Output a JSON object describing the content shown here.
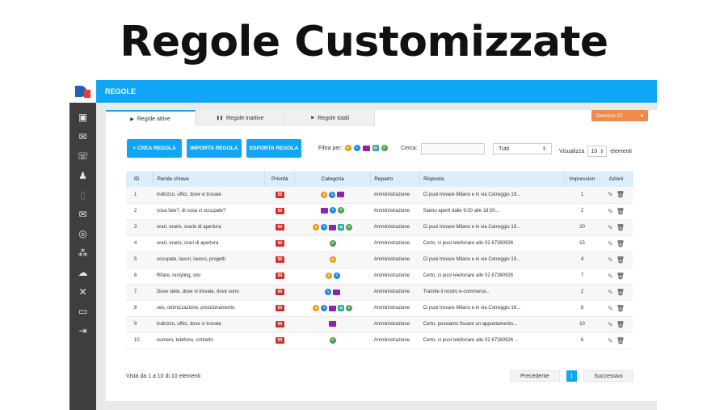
{
  "headline": "Regole Customizzate",
  "topbar": {
    "title": "REGOLE"
  },
  "sidebar": {
    "icons": [
      "dashboard-icon",
      "inbox-icon",
      "support-icon",
      "team-icon",
      "tablet-icon",
      "mail-settings-icon",
      "check-circle-icon",
      "network-icon",
      "chat-icon",
      "tools-icon",
      "monitor-icon",
      "logout-icon"
    ]
  },
  "tabs": [
    {
      "label": "Regole attive",
      "glyph": "▶"
    },
    {
      "label": "Regole inattive",
      "glyph": "❚❚"
    },
    {
      "label": "Regole totali",
      "glyph": "⚑"
    }
  ],
  "domain_select": {
    "label": "Dominio 01",
    "caret": "▾"
  },
  "toolbar": {
    "create": "+ CREA REGOLA",
    "import": "IMPORTA REGOLA",
    "export": "ESPORTA REGOLA"
  },
  "filter": {
    "label": "Filtra per:"
  },
  "search": {
    "label": "Cerca:",
    "value": ""
  },
  "status_select": {
    "value": "Tutti",
    "caret": "⇕"
  },
  "page_size": {
    "label": "Visualizza",
    "value": "10",
    "caret": "⇕",
    "suffix": "elementi"
  },
  "table": {
    "headers": [
      "ID",
      "Parole chiave",
      "Priorità",
      "Categoria",
      "Reparto",
      "Risposta",
      "Impression",
      "Azioni"
    ],
    "rows": [
      {
        "id": "1",
        "kw": "indirizzo, uffici, dove vi trovate",
        "prio": "50",
        "cats": [
          "chat",
          "msgr",
          "mail"
        ],
        "rep": "Amministrazione",
        "ans": "Ci puoi trovare Milano e in via Correggio 19...",
        "imp": "1"
      },
      {
        "id": "2",
        "kw": "cosa fate?, di cosa vi occupate?",
        "prio": "50",
        "cats": [
          "mail",
          "msgr",
          "wa"
        ],
        "rep": "Amministrazione",
        "ans": "Siamo aperti dalle 9:00 alle 18:00...",
        "imp": "2"
      },
      {
        "id": "3",
        "kw": "orari, orario, orario di apertura",
        "prio": "50",
        "cats": [
          "chat",
          "msgr",
          "mail",
          "sms",
          "wa"
        ],
        "rep": "Amministrazione",
        "ans": "Ci puoi trovare Milano e in via Correggio 19...",
        "imp": "20"
      },
      {
        "id": "4",
        "kw": "orari, orario, orari di apertura",
        "prio": "50",
        "cats": [
          "wa"
        ],
        "rep": "Amministrazione",
        "ans": "Certo, ci puoi telefonare allo 02 87260926",
        "imp": "15"
      },
      {
        "id": "5",
        "kw": "occupate, lavori, lavoro, progetti",
        "prio": "50",
        "cats": [
          "chat"
        ],
        "rep": "Amministrazione",
        "ans": "Ci puoi trovare Milano e in via Correggio 19...",
        "imp": "4"
      },
      {
        "id": "6",
        "kw": "Rifare, restyling, sito",
        "prio": "50",
        "cats": [
          "chat",
          "msgr"
        ],
        "rep": "Amministrazione",
        "ans": "Certo, ci puoi telefonare allo 02 87260926",
        "imp": "7"
      },
      {
        "id": "7",
        "kw": "Dove siete, dove vi trovate, dove sono",
        "prio": "50",
        "cats": [
          "msgr",
          "mail"
        ],
        "rep": "Amministrazione",
        "ans": "Tramite il nostro e-commerce...",
        "imp": "2"
      },
      {
        "id": "8",
        "kw": "seo, ottimizzazione, posizionamento",
        "prio": "50",
        "cats": [
          "chat",
          "msgr",
          "mail",
          "sms",
          "wa"
        ],
        "rep": "Amministrazione",
        "ans": "Ci puoi trovare Milano e in via Correggio 19...",
        "imp": "8"
      },
      {
        "id": "9",
        "kw": "indirizzo, uffici, dove vi trovate",
        "prio": "50",
        "cats": [
          "mail"
        ],
        "rep": "Amministrazione",
        "ans": "Certo, possiamo fissare un appuntamento...",
        "imp": "10"
      },
      {
        "id": "10",
        "kw": "numero, telefono, contatto",
        "prio": "50",
        "cats": [
          "wa"
        ],
        "rep": "Amministrazione",
        "ans": "Certo, ci puoi telefonare allo 02 87260926 ...",
        "imp": "6"
      }
    ]
  },
  "footer": {
    "info": "Vista da 1 a 10 di 10 elementi",
    "prev": "Precedente",
    "page": "1",
    "next": "Successivo"
  },
  "colors": {
    "accent": "#11a6f5",
    "domain": "#f08a4b",
    "priority": "#d32f2f"
  }
}
